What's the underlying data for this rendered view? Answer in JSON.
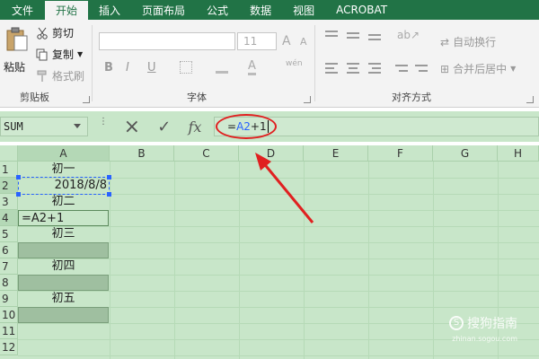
{
  "tabs": [
    {
      "label": "文件",
      "active": false
    },
    {
      "label": "开始",
      "active": true
    },
    {
      "label": "插入",
      "active": false
    },
    {
      "label": "页面布局",
      "active": false
    },
    {
      "label": "公式",
      "active": false
    },
    {
      "label": "数据",
      "active": false
    },
    {
      "label": "视图",
      "active": false
    },
    {
      "label": "ACROBAT",
      "active": false
    }
  ],
  "ribbon": {
    "clipboard": {
      "paste_label": "粘贴",
      "cut_label": "剪切",
      "copy_label": "复制",
      "format_painter_label": "格式刷",
      "group_label": "剪贴板"
    },
    "font": {
      "size_value": "11",
      "grow_label": "A",
      "shrink_label": "A",
      "bold_label": "B",
      "italic_label": "I",
      "underline_label": "U",
      "phonetic_label": "wén",
      "group_label": "字体"
    },
    "alignment": {
      "wrap_label": "自动换行",
      "merge_label": "合并后居中",
      "group_label": "对齐方式"
    }
  },
  "formula_bar": {
    "name_box": "SUM",
    "cancel_icon": "×",
    "enter_icon": "✓",
    "fx_label": "fx",
    "formula_prefix": "=",
    "formula_ref": "A2",
    "formula_suffix": "+1"
  },
  "grid": {
    "columns": [
      "A",
      "B",
      "C",
      "D",
      "E",
      "F",
      "G",
      "H"
    ],
    "rows": [
      "1",
      "2",
      "3",
      "4",
      "5",
      "6",
      "7",
      "8",
      "9",
      "10",
      "11",
      "12"
    ],
    "cells": {
      "A1": "初一",
      "A2": "2018/8/8",
      "A3": "初二",
      "A4": "=A2+1",
      "A5": "初三",
      "A7": "初四",
      "A9": "初五"
    }
  },
  "watermark": {
    "text": "搜狗指南",
    "sub": "zhinan.sogou.com"
  },
  "colors": {
    "ribbon_green": "#217346",
    "sheet_bg": "#c8e6c9",
    "annotation_red": "#e02020",
    "ref_blue": "#2962ff"
  }
}
